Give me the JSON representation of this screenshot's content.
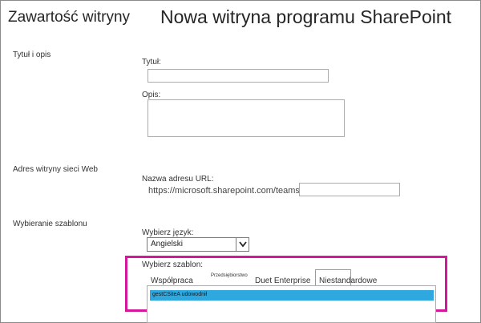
{
  "header": {
    "breadcrumb": "Zawartość witryny",
    "page_title": "Nowa witryna programu SharePoint"
  },
  "sections": {
    "title_description": {
      "label": "Tytuł i opis",
      "title_label": "Tytuł:",
      "title_value": "",
      "description_label": "Opis:",
      "description_value": ""
    },
    "web_address": {
      "label": "Adres witryny sieci Web",
      "url_label": "Nazwa adresu URL:",
      "url_prefix": "https://microsoft.sharepoint.com/teams/",
      "url_value": ""
    },
    "template": {
      "label": "Wybieranie szablonu",
      "language_label": "Wybierz język:",
      "language_selected": "Angielski",
      "template_label": "Wybierz szablon:",
      "tabs": [
        {
          "label": "Współpraca"
        },
        {
          "label": "Przedsiębiorstwo"
        },
        {
          "label": "Duet Enterprise"
        },
        {
          "label": "Niestandardowe",
          "active": true
        }
      ],
      "templates": [
        {
          "label": "gestCSiteA udowodnił",
          "selected": true
        }
      ]
    }
  },
  "colors": {
    "highlight": "#d4189b",
    "selection": "#2fa8e0"
  }
}
